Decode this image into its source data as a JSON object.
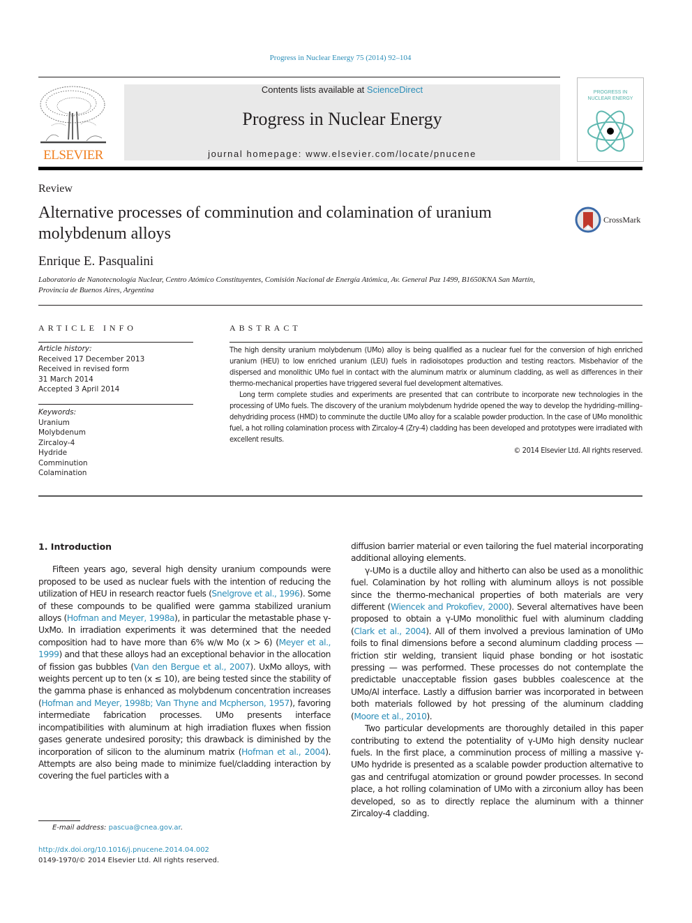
{
  "header": {
    "journal_ref": "Progress in Nuclear Energy 75 (2014) 92–104",
    "contents_prefix": "Contents lists available at ",
    "contents_link": "ScienceDirect",
    "journal_title": "Progress in Nuclear Energy",
    "homepage_prefix": "journal homepage: ",
    "homepage_url": "www.elsevier.com/locate/pnucene",
    "publisher_logo": "ELSEVIER",
    "cover_title_line1": "PROGRESS IN",
    "cover_title_line2": "NUCLEAR ENERGY",
    "colors": {
      "link": "#2a8db8",
      "elsevier_orange": "#f07f1f",
      "cover_teal": "#4fb0a8",
      "header_box": "#e9e9e9"
    }
  },
  "article": {
    "type": "Review",
    "title": "Alternative processes of comminution and colamination of uranium molybdenum alloys",
    "crossmark_label": "CrossMark",
    "author": "Enrique E. Pasqualini",
    "affiliation": "Laboratorio de Nanotecnología Nuclear, Centro Atómico Constituyentes, Comisión Nacional de Energía Atómica, Av. General Paz 1499, B1650KNA San Martín, Provincia de Buenos Aires, Argentina"
  },
  "article_info": {
    "heading": "ARTICLE INFO",
    "history_label": "Article history:",
    "history": [
      "Received 17 December 2013",
      "Received in revised form",
      "31 March 2014",
      "Accepted 3 April 2014"
    ],
    "keywords_label": "Keywords:",
    "keywords": [
      "Uranium",
      "Molybdenum",
      "Zircaloy-4",
      "Hydride",
      "Comminution",
      "Colamination"
    ]
  },
  "abstract": {
    "heading": "ABSTRACT",
    "paragraphs": [
      "The high density uranium molybdenum (UMo) alloy is being qualified as a nuclear fuel for the conversion of high enriched uranium (HEU) to low enriched uranium (LEU) fuels in radioisotopes production and testing reactors. Misbehavior of the dispersed and monolithic UMo fuel in contact with the aluminum matrix or aluminum cladding, as well as differences in their thermo-mechanical properties have triggered several fuel development alternatives.",
      "Long term complete studies and experiments are presented that can contribute to incorporate new technologies in the processing of UMo fuels. The discovery of the uranium molybdenum hydride opened the way to develop the hydriding–milling–dehydriding process (HMD) to comminute the ductile UMo alloy for a scalable powder production. In the case of UMo monolithic fuel, a hot rolling colamination process with Zircaloy-4 (Zry-4) cladding has been developed and prototypes were irradiated with excellent results."
    ],
    "copyright": "© 2014 Elsevier Ltd. All rights reserved."
  },
  "body": {
    "section_heading": "1.  Introduction",
    "left": {
      "p1_a": "Fifteen years ago, several high density uranium compounds were proposed to be used as nuclear fuels with the intention of reducing the utilization of HEU in research reactor fuels (",
      "ref1": "Snelgrove et al., 1996",
      "p1_b": "). Some of these compounds to be qualified were gamma stabilized uranium alloys (",
      "ref2": "Hofman and Meyer, 1998a",
      "p1_c": "), in particular the metastable phase γ-UxMo. In irradiation experiments it was determined that the needed composition had to have more than 6% w/w Mo (x > 6) (",
      "ref3": "Meyer et al., 1999",
      "p1_d": ") and that these alloys had an exceptional behavior in the allocation of fission gas bubbles (",
      "ref4": "Van den Bergue et al., 2007",
      "p1_e": "). UxMo alloys, with weights percent up to ten (x ≤ 10), are being tested since the stability of the gamma phase is enhanced as molybdenum concentration increases (",
      "ref5": "Hofman and Meyer, 1998b; Van Thyne and Mcpherson, 1957",
      "p1_f": "), favoring intermediate fabrication processes. UMo presents interface incompatibilities with aluminum at high irradiation fluxes when fission gases generate undesired porosity; this drawback is diminished by the incorporation of silicon to the aluminum matrix (",
      "ref6": "Hofman et al., 2004",
      "p1_g": "). Attempts are also being made to minimize fuel/cladding interaction by covering the fuel particles with a"
    },
    "right": {
      "p0": "diffusion barrier material or even tailoring the fuel material incorporating additional alloying elements.",
      "p2_a": "γ-UMo is a ductile alloy and hitherto can also be used as a monolithic fuel. Colamination by hot rolling with aluminum alloys is not possible since the thermo-mechanical properties of both materials are very different (",
      "ref7": "Wiencek and Prokofiev, 2000",
      "p2_b": "). Several alternatives have been proposed to obtain a γ-UMo monolithic fuel with aluminum cladding (",
      "ref8": "Clark et al., 2004",
      "p2_c": "). All of them involved a previous lamination of UMo foils to final dimensions before a second aluminum cladding process — friction stir welding, transient liquid phase bonding or hot isostatic pressing — was performed. These processes do not contemplate the predictable unacceptable fission gases bubbles coalescence at the UMo/Al interface. Lastly a diffusion barrier was incorporated in between both materials followed by hot pressing of the aluminum cladding (",
      "ref9": "Moore et al., 2010",
      "p2_d": ").",
      "p3": "Two particular developments are thoroughly detailed in this paper contributing to extend the potentiality of γ-UMo high density nuclear fuels. In the first place, a comminution process of milling a massive γ-UMo hydride is presented as a scalable powder production alternative to gas and centrifugal atomization or ground powder processes. In second place, a hot rolling colamination of UMo with a zirconium alloy has been developed, so as to directly replace the aluminum with a thinner Zircaloy-4 cladding."
    }
  },
  "footer": {
    "email_label": "E-mail address:",
    "email": "pascua@cnea.gov.ar",
    "email_suffix": ".",
    "doi": "http://dx.doi.org/10.1016/j.pnucene.2014.04.002",
    "issn_line": "0149-1970/© 2014 Elsevier Ltd. All rights reserved."
  }
}
